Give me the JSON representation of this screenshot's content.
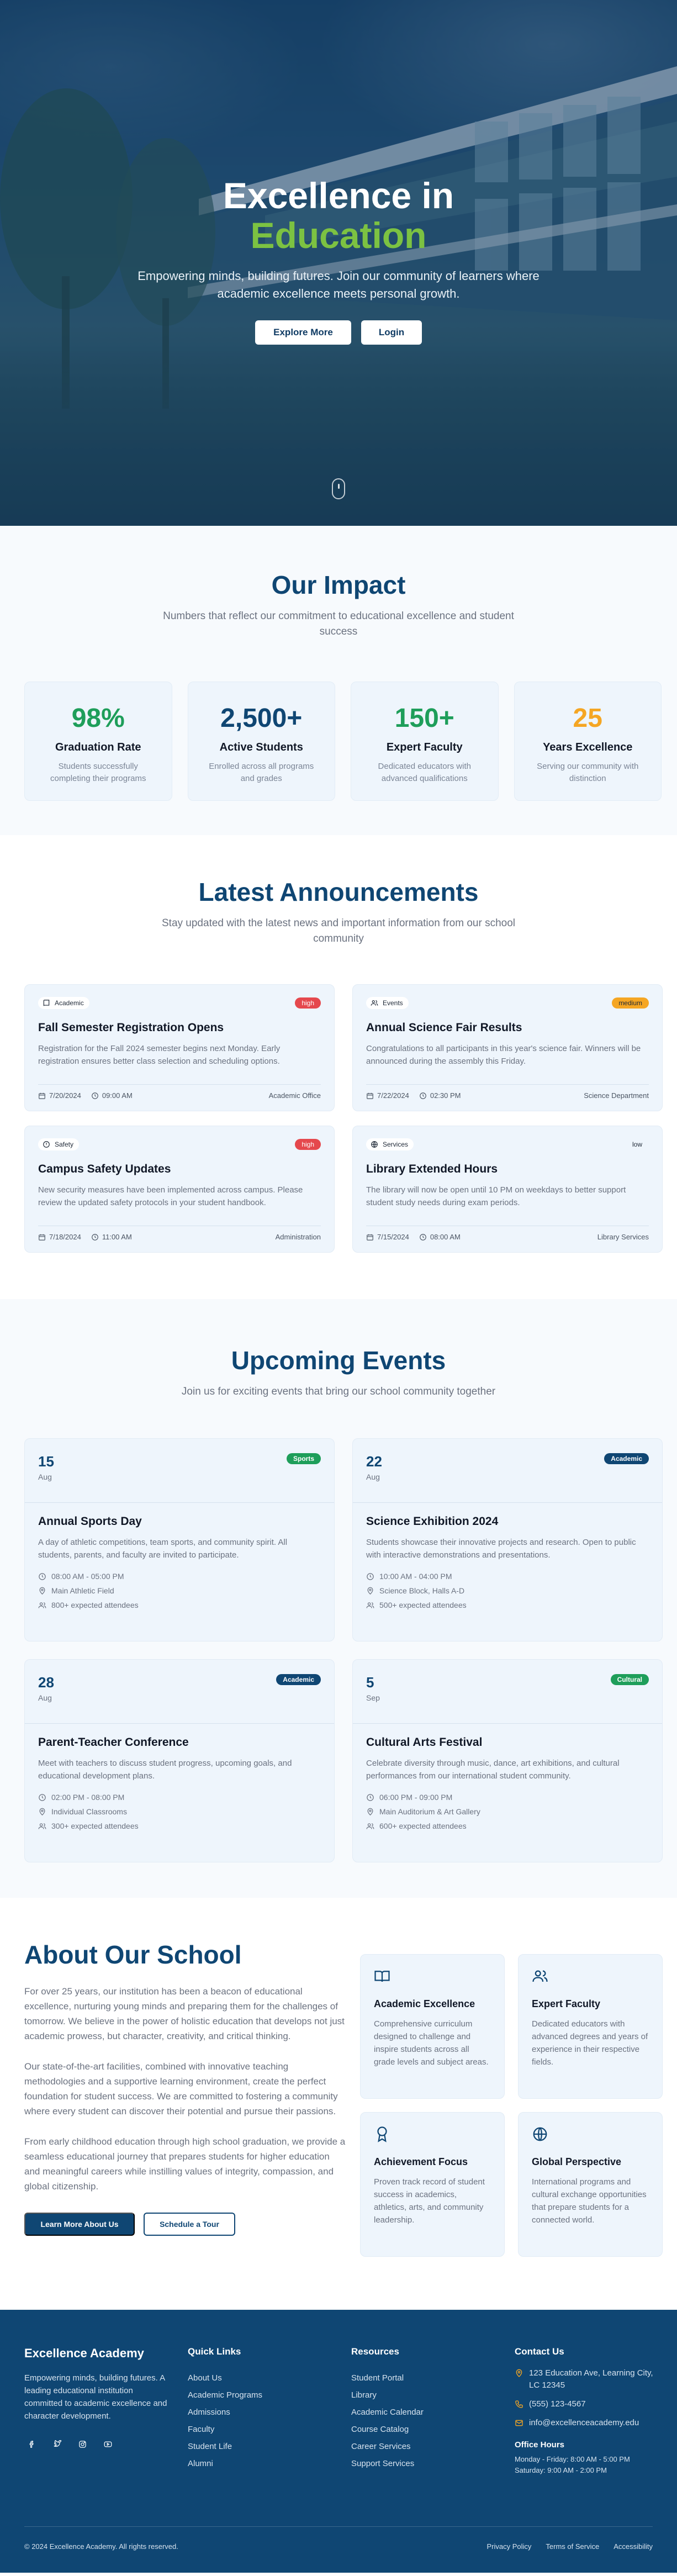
{
  "hero": {
    "title_line1": "Excellence in",
    "title_line2": "Education",
    "subtitle": "Empowering minds, building futures. Join our community of learners where academic excellence meets personal growth.",
    "btn_explore": "Explore More",
    "btn_login": "Login"
  },
  "impact": {
    "title": "Our Impact",
    "subtitle": "Numbers that reflect our commitment to educational excellence and student success",
    "stats": [
      {
        "value": "98%",
        "label": "Graduation Rate",
        "desc": "Students successfully completing their programs",
        "color": "#1e9e5a"
      },
      {
        "value": "2,500+",
        "label": "Active Students",
        "desc": "Enrolled across all programs and grades",
        "color": "#0f4673"
      },
      {
        "value": "150+",
        "label": "Expert Faculty",
        "desc": "Dedicated educators with advanced qualifications",
        "color": "#1e9e5a"
      },
      {
        "value": "25",
        "label": "Years Excellence",
        "desc": "Serving our community with distinction",
        "color": "#f5a623"
      }
    ]
  },
  "announcements": {
    "title": "Latest Announcements",
    "subtitle": "Stay updated with the latest news and important information from our school community",
    "items": [
      {
        "category": "Academic",
        "priority": "high",
        "title": "Fall Semester Registration Opens",
        "body": "Registration for the Fall 2024 semester begins next Monday. Early registration ensures better class selection and scheduling options.",
        "date": "7/20/2024",
        "time": "09:00 AM",
        "dept": "Academic Office"
      },
      {
        "category": "Events",
        "priority": "medium",
        "title": "Annual Science Fair Results",
        "body": "Congratulations to all participants in this year's science fair. Winners will be announced during the assembly this Friday.",
        "date": "7/22/2024",
        "time": "02:30 PM",
        "dept": "Science Department"
      },
      {
        "category": "Safety",
        "priority": "high",
        "title": "Campus Safety Updates",
        "body": "New security measures have been implemented across campus. Please review the updated safety protocols in your student handbook.",
        "date": "7/18/2024",
        "time": "11:00 AM",
        "dept": "Administration"
      },
      {
        "category": "Services",
        "priority": "low",
        "title": "Library Extended Hours",
        "body": "The library will now be open until 10 PM on weekdays to better support student study needs during exam periods.",
        "date": "7/15/2024",
        "time": "08:00 AM",
        "dept": "Library Services"
      }
    ]
  },
  "events": {
    "title": "Upcoming Events",
    "subtitle": "Join us for exciting events that bring our school community together",
    "items": [
      {
        "day": "15",
        "month": "Aug",
        "tag": "Sports",
        "tag_color": "#1e9e5a",
        "title": "Annual Sports Day",
        "desc": "A day of athletic competitions, team sports, and community spirit. All students, parents, and faculty are invited to participate.",
        "time": "08:00 AM - 05:00 PM",
        "location": "Main Athletic Field",
        "attendees": "800+ expected attendees"
      },
      {
        "day": "22",
        "month": "Aug",
        "tag": "Academic",
        "tag_color": "#0f4673",
        "title": "Science Exhibition 2024",
        "desc": "Students showcase their innovative projects and research. Open to public with interactive demonstrations and presentations.",
        "time": "10:00 AM - 04:00 PM",
        "location": "Science Block, Halls A-D",
        "attendees": "500+ expected attendees"
      },
      {
        "day": "28",
        "month": "Aug",
        "tag": "Academic",
        "tag_color": "#0f4673",
        "title": "Parent-Teacher Conference",
        "desc": "Meet with teachers to discuss student progress, upcoming goals, and educational development plans.",
        "time": "02:00 PM - 08:00 PM",
        "location": "Individual Classrooms",
        "attendees": "300+ expected attendees"
      },
      {
        "day": "5",
        "month": "Sep",
        "tag": "Cultural",
        "tag_color": "#1e9e5a",
        "title": "Cultural Arts Festival",
        "desc": "Celebrate diversity through music, dance, art exhibitions, and cultural performances from our international student community.",
        "time": "06:00 PM - 09:00 PM",
        "location": "Main Auditorium & Art Gallery",
        "attendees": "600+ expected attendees"
      }
    ]
  },
  "about": {
    "title": "About Our School",
    "p1": "For over 25 years, our institution has been a beacon of educational excellence, nurturing young minds and preparing them for the challenges of tomorrow. We believe in the power of holistic education that develops not just academic prowess, but character, creativity, and critical thinking.",
    "p2": "Our state-of-the-art facilities, combined with innovative teaching methodologies and a supportive learning environment, create the perfect foundation for student success. We are committed to fostering a community where every student can discover their potential and pursue their passions.",
    "p3": "From early childhood education through high school graduation, we provide a seamless educational journey that prepares students for higher education and meaningful careers while instilling values of integrity, compassion, and global citizenship.",
    "btn_learn": "Learn More About Us",
    "btn_tour": "Schedule a Tour",
    "features": [
      {
        "icon": "book-icon",
        "title": "Academic Excellence",
        "desc": "Comprehensive curriculum designed to challenge and inspire students across all grade levels and subject areas."
      },
      {
        "icon": "users-icon",
        "title": "Expert Faculty",
        "desc": "Dedicated educators with advanced degrees and years of experience in their respective fields."
      },
      {
        "icon": "award-icon",
        "title": "Achievement Focus",
        "desc": "Proven track record of student success in academics, athletics, arts, and community leadership."
      },
      {
        "icon": "globe-icon",
        "title": "Global Perspective",
        "desc": "International programs and cultural exchange opportunities that prepare students for a connected world."
      }
    ]
  },
  "footer": {
    "brand": "Excellence Academy",
    "brand_desc": "Empowering minds, building futures. A leading educational institution committed to academic excellence and character development.",
    "quick_title": "Quick Links",
    "quick_links": [
      "About Us",
      "Academic Programs",
      "Admissions",
      "Faculty",
      "Student Life",
      "Alumni"
    ],
    "res_title": "Resources",
    "res_links": [
      "Student Portal",
      "Library",
      "Academic Calendar",
      "Course Catalog",
      "Career Services",
      "Support Services"
    ],
    "contact_title": "Contact Us",
    "address": "123 Education Ave, Learning City, LC 12345",
    "phone": "(555) 123-4567",
    "email": "info@excellenceacademy.edu",
    "hours_title": "Office Hours",
    "hours1": "Monday - Friday: 8:00 AM - 5:00 PM",
    "hours2": "Saturday: 9:00 AM - 2:00 PM",
    "copyright": "© 2024 Excellence Academy. All rights reserved.",
    "legal": [
      "Privacy Policy",
      "Terms of Service",
      "Accessibility"
    ]
  }
}
